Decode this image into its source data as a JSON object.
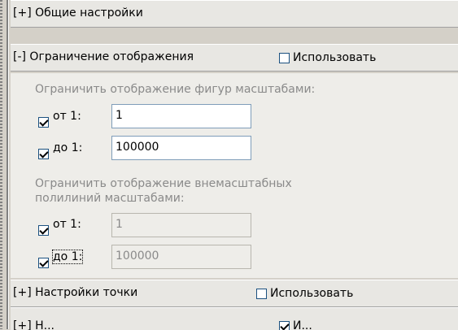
{
  "sections": {
    "general": {
      "label": "[+] Общие настройки"
    },
    "display_limit": {
      "label": "[-] Ограничение отображения",
      "use_label": "Использовать",
      "use_checked": false,
      "shapes_caption": "Ограничить отображение фигур масштабами:",
      "shapes_from_label": "от 1:",
      "shapes_from_value": "1",
      "shapes_from_checked": true,
      "shapes_to_label": "до 1:",
      "shapes_to_value": "100000",
      "shapes_to_checked": true,
      "polylines_caption_1": "Ограничить отображение внемасштабных",
      "polylines_caption_2": "полилиний масштабами:",
      "poly_from_label": "от 1:",
      "poly_from_value": "1",
      "poly_from_checked": true,
      "poly_to_label": "до 1:",
      "poly_to_value": "100000",
      "poly_to_checked": true
    },
    "point": {
      "label": "[+] Настройки точки",
      "use_label": "Использовать",
      "use_checked": false
    },
    "next": {
      "label": "[+] Н...",
      "use_label": "И...",
      "use_checked": true
    }
  },
  "colors": {
    "background": "#d4d0c8",
    "header": "#e8e7e3",
    "body": "#eeede9",
    "field_border": "#7f9db9",
    "check_border": "#1c5180",
    "disabled_text": "#8a8a8a"
  }
}
